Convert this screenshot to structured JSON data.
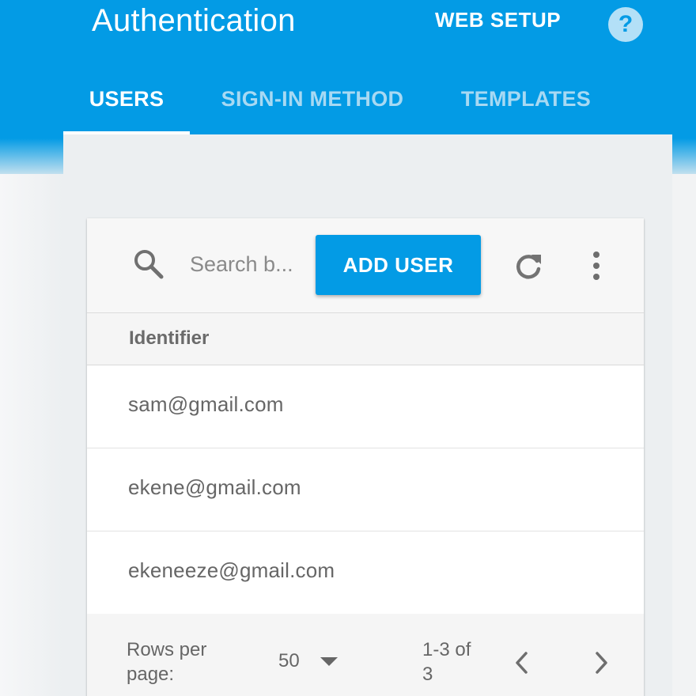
{
  "header": {
    "title": "Authentication",
    "web_setup_label": "WEB SETUP",
    "help_icon_glyph": "?"
  },
  "tabs": [
    {
      "label": "USERS",
      "active": true
    },
    {
      "label": "SIGN-IN METHOD",
      "active": false
    },
    {
      "label": "TEMPLATES",
      "active": false
    }
  ],
  "toolbar": {
    "search_placeholder": "Search b...",
    "add_user_label": "ADD USER",
    "icons": [
      "search-icon",
      "refresh-icon",
      "more-vert-icon"
    ]
  },
  "table": {
    "columns": [
      "Identifier"
    ],
    "rows": [
      {
        "identifier": "sam@gmail.com"
      },
      {
        "identifier": "ekene@gmail.com"
      },
      {
        "identifier": "ekeneeze@gmail.com"
      }
    ]
  },
  "pagination": {
    "rows_per_page_label": "Rows per page:",
    "rows_per_page_value": "50",
    "range_text": "1-3 of 3"
  },
  "colors": {
    "brand_blue": "#039be5",
    "tab_inactive": "#a7d9f3",
    "page_bg": "#eceff1"
  }
}
